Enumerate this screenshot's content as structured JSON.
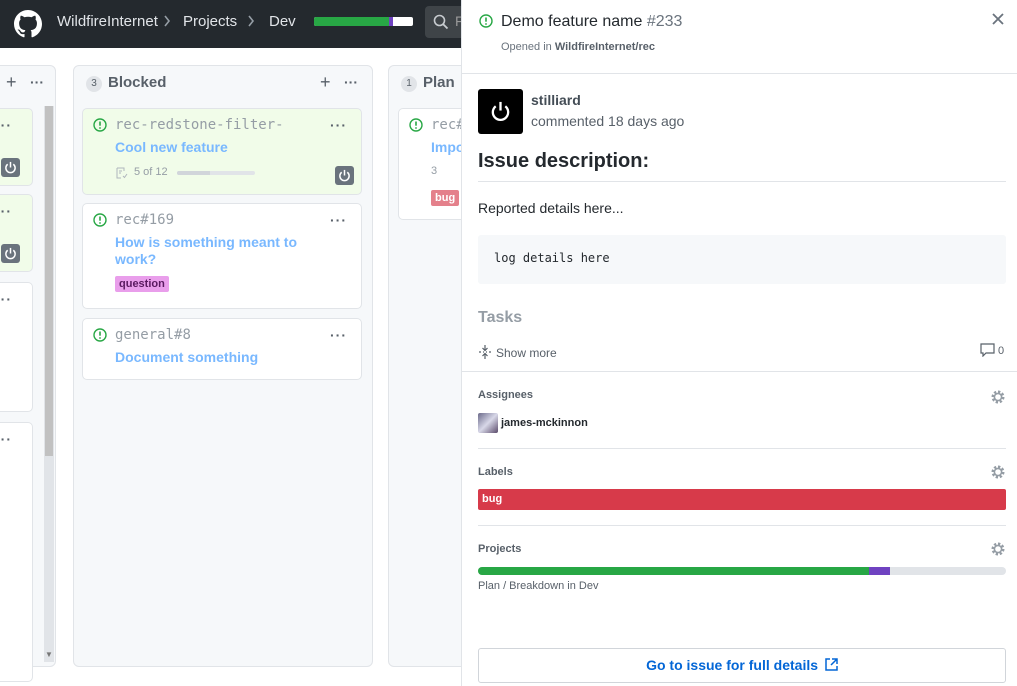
{
  "header": {
    "org": "WildfireInternet",
    "projects": "Projects",
    "project": "Dev",
    "progress": {
      "done": 0.76,
      "in_progress": 0.04,
      "colors": {
        "done": "#28a745",
        "in_progress": "#6f42c1",
        "todo": "#ffffff"
      }
    },
    "search_placeholder": "F"
  },
  "board": {
    "columns": [
      {
        "name": "",
        "count": ""
      },
      {
        "name": "Blocked",
        "count": "3"
      },
      {
        "name": "Plan",
        "count": "1"
      }
    ],
    "cards": {
      "c1": {
        "ref_repo": "rec-redstone-filter-",
        "ref_num": "",
        "title": "Cool new feature",
        "tasks": "5 of 12",
        "task_fraction": 0.42
      },
      "c2": {
        "ref_repo": "rec",
        "ref_num": "#169",
        "title": "How is something meant to work?",
        "label": "question"
      },
      "c3": {
        "ref_repo": "general",
        "ref_num": "#8",
        "title": "Document something"
      },
      "c4": {
        "ref_repo": "rec#",
        "title": "Impo",
        "tasks": "3",
        "label": "bug"
      }
    }
  },
  "panel": {
    "title": "Demo feature name",
    "number": "#233",
    "opened_in_prefix": "Opened in",
    "repo": "WildfireInternet/rec",
    "author": "stilliard",
    "action": "commented 18 days ago",
    "description_heading": "Issue description:",
    "description_text": "Reported details here...",
    "code": "log details here",
    "tasks_heading": "Tasks",
    "show_more": "Show more",
    "comment_count": "0",
    "assignees_heading": "Assignees",
    "assignee": "james-mckinnon",
    "labels_heading": "Labels",
    "label": "bug",
    "label_color": "#d73a4a",
    "projects_heading": "Projects",
    "project_progress": {
      "done": 0.74,
      "in_progress": 0.04
    },
    "project_column": "Plan / Breakdown in Dev",
    "full_details": "Go to issue for full details"
  }
}
